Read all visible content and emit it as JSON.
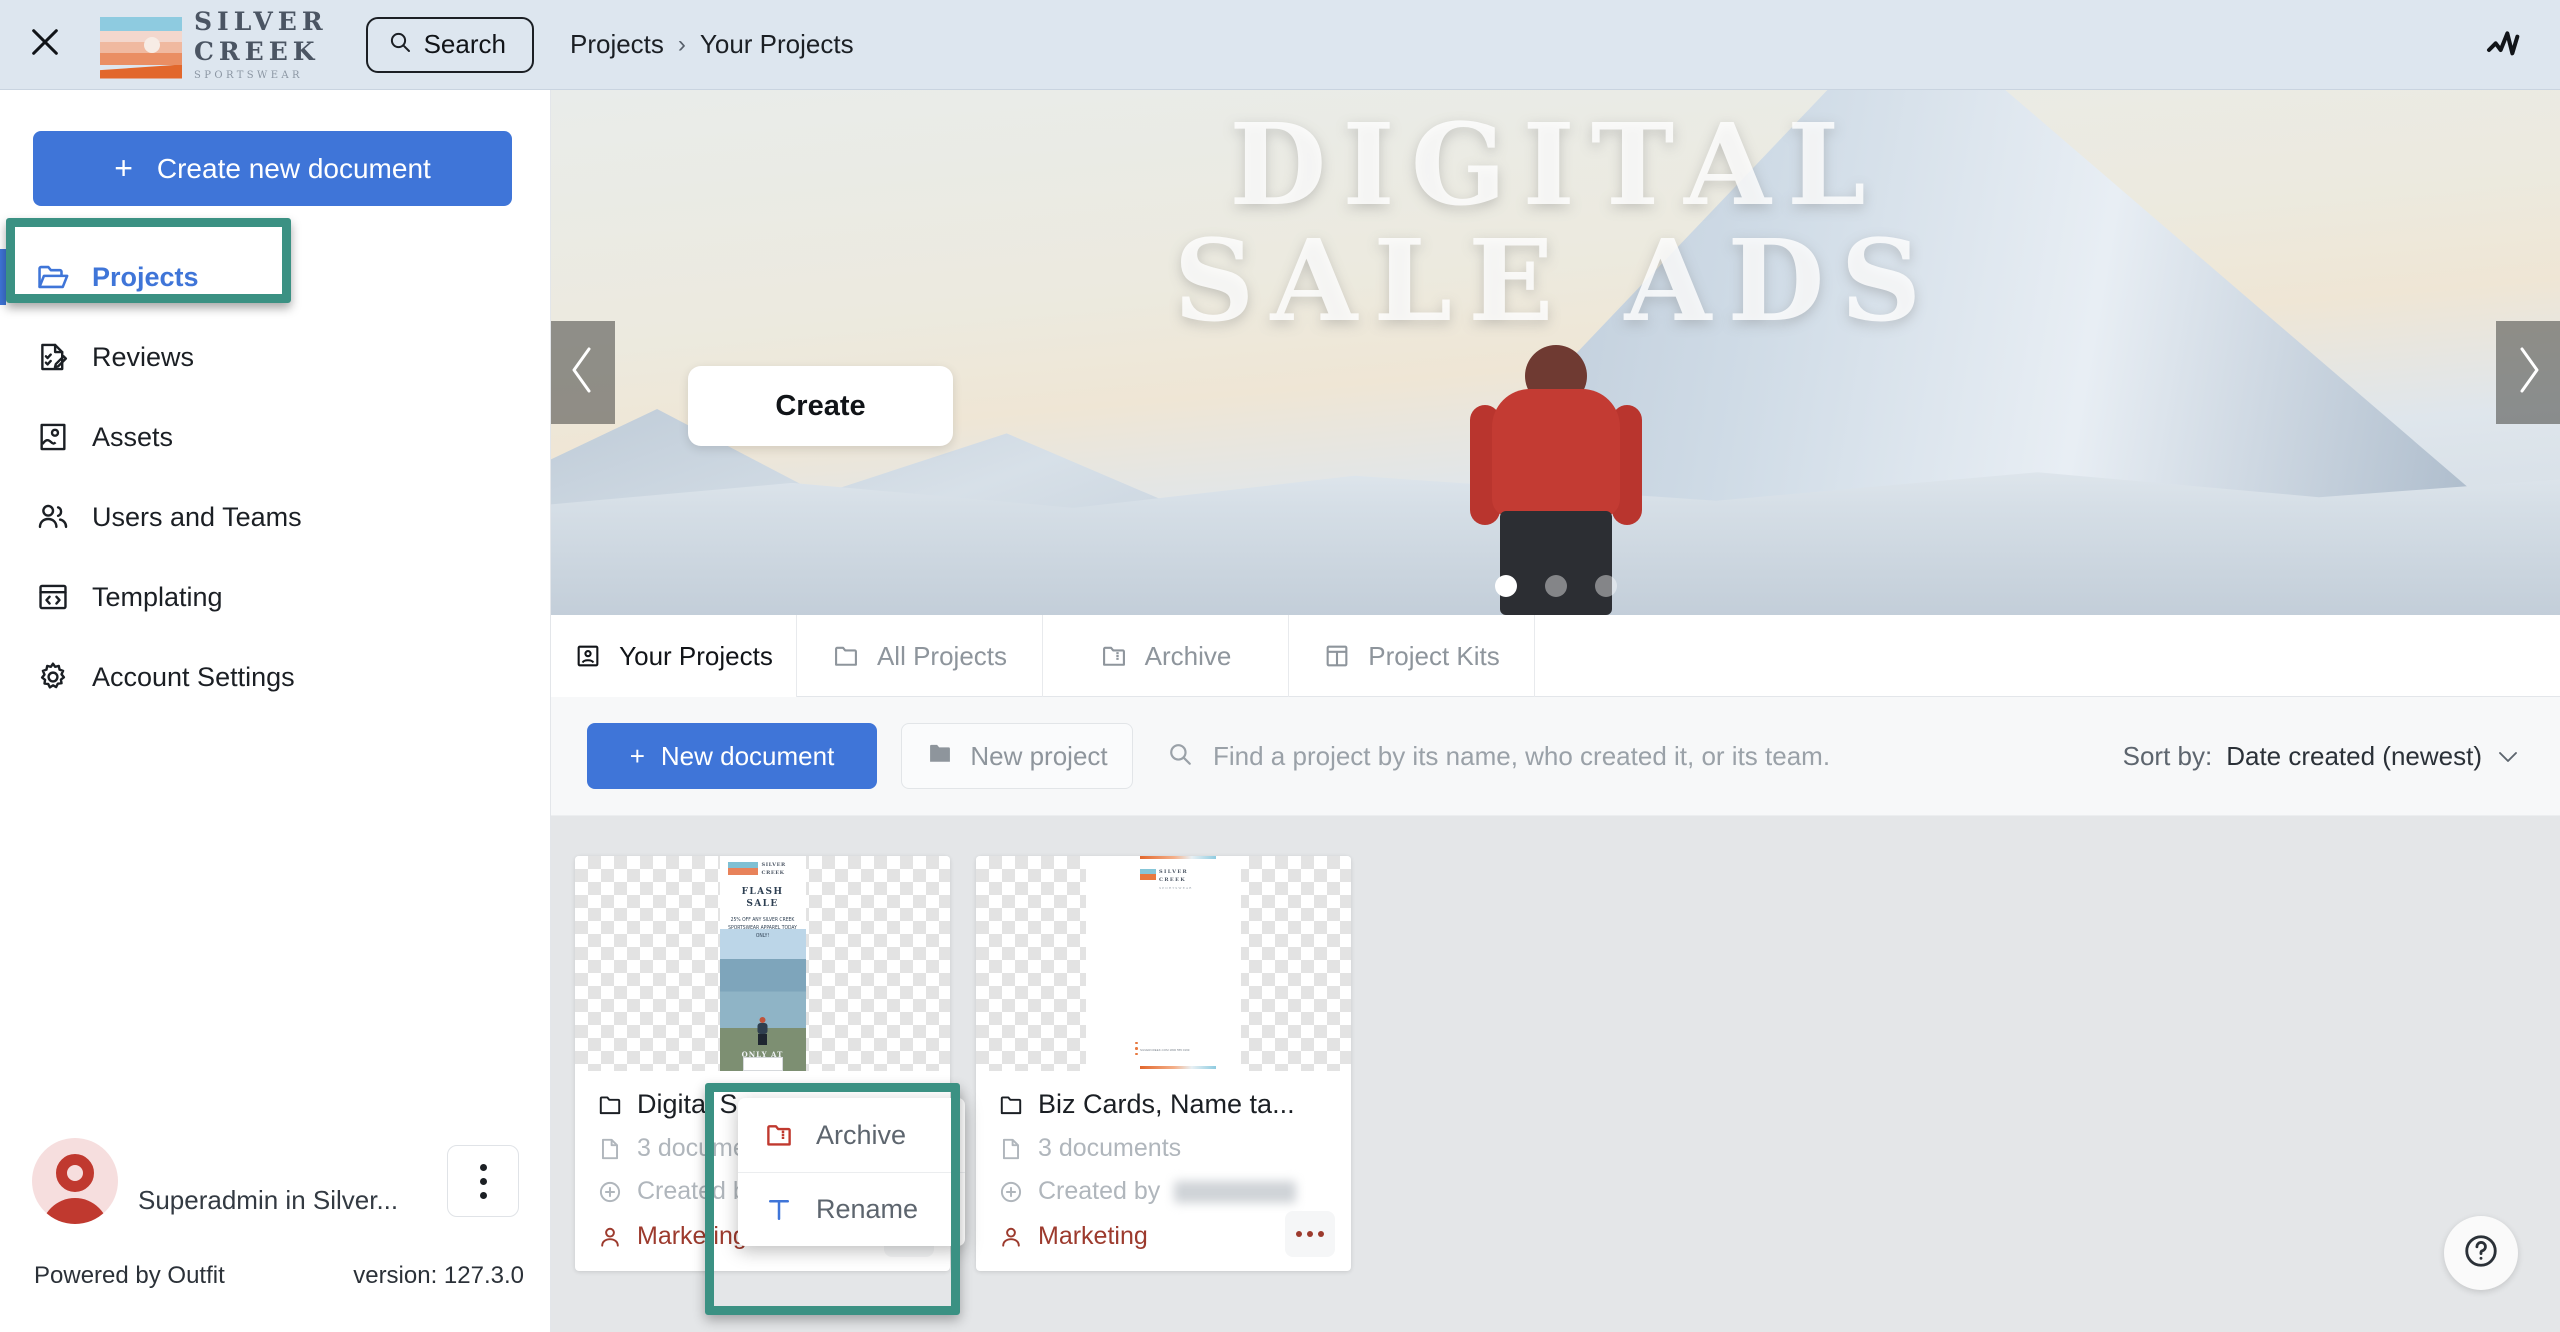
{
  "topbar": {
    "close_label": "close-icon",
    "brand": {
      "line1": "SILVER",
      "line2": "CREEK",
      "line3": "SPORTSWEAR"
    },
    "search_label": "Search",
    "breadcrumb": {
      "root": "Projects",
      "separator": "›",
      "current": "Your Projects"
    },
    "activity_icon": "activity-chart-icon"
  },
  "sidebar": {
    "create_document_label": "Create new document",
    "create_document_plus": "+",
    "items": [
      {
        "label": "Projects",
        "icon": "folder-open-icon",
        "active": true
      },
      {
        "label": "Reviews",
        "icon": "review-document-icon",
        "active": false
      },
      {
        "label": "Assets",
        "icon": "image-asset-icon",
        "active": false
      },
      {
        "label": "Users and Teams",
        "icon": "users-icon",
        "active": false
      },
      {
        "label": "Templating",
        "icon": "code-window-icon",
        "active": false
      },
      {
        "label": "Account Settings",
        "icon": "gear-icon",
        "active": false
      }
    ],
    "user": {
      "name": "",
      "role": "Superadmin in Silver..."
    },
    "footer": {
      "powered_by": "Powered by Outfit",
      "version": "version: 127.3.0"
    }
  },
  "hero": {
    "title_line1": "DIGITAL",
    "title_line2": "SALE ADS",
    "create_label": "Create",
    "prev_icon": "chevron-left-icon",
    "next_icon": "chevron-right-icon",
    "slides": 3,
    "active_slide": 1
  },
  "tabs": [
    {
      "label": "Your Projects",
      "icon": "your-projects-icon",
      "active": true
    },
    {
      "label": "All Projects",
      "icon": "folder-icon",
      "active": false
    },
    {
      "label": "Archive",
      "icon": "archive-icon",
      "active": false
    },
    {
      "label": "Project Kits",
      "icon": "kit-icon",
      "active": false
    }
  ],
  "toolbar": {
    "new_document_label": "New document",
    "new_document_plus": "+",
    "new_project_label": "New project",
    "find_placeholder": "Find a project by its name, who created it, or its team.",
    "sort_label": "Sort by:",
    "sort_value": "Date created (newest)"
  },
  "cards": [
    {
      "title": "Digital S...",
      "documents": "3 documents",
      "created_by": "Created by",
      "team": "Marketing",
      "thumb_type": "banner",
      "thumb_art": {
        "brand_l1": "SILVER",
        "brand_l2": "CREEK",
        "headline_l1": "FLASH",
        "headline_l2": "SALE",
        "sub": "25% OFF ANY SILVER CREEK SPORTSWEAR APPAREL TODAY ONLY!",
        "footer": "ONLY AT"
      }
    },
    {
      "title": "Biz Cards, Name ta...",
      "documents": "3 documents",
      "created_by": "Created by",
      "team": "Marketing",
      "thumb_type": "letterhead",
      "thumb_art": {
        "brand_l1": "SILVER",
        "brand_l2": "CREEK",
        "brand_l3": "SPORTSWEAR",
        "footer": "SILVERCREEK.COM\n1800 555 0199"
      }
    }
  ],
  "context_menu": {
    "items": [
      {
        "label": "Archive",
        "icon": "archive-folder-icon",
        "color": "#c0392f"
      },
      {
        "label": "Rename",
        "icon": "text-cursor-icon",
        "color": "#3f75d8"
      }
    ]
  },
  "help": {
    "icon": "question-circle-icon"
  },
  "colors": {
    "accent_blue": "#3f75d8",
    "topbar_bg": "#dde6ef",
    "annotation_green": "#3b9183",
    "team_red": "#9c3a2d",
    "cards_bg": "#e4e6e8"
  }
}
